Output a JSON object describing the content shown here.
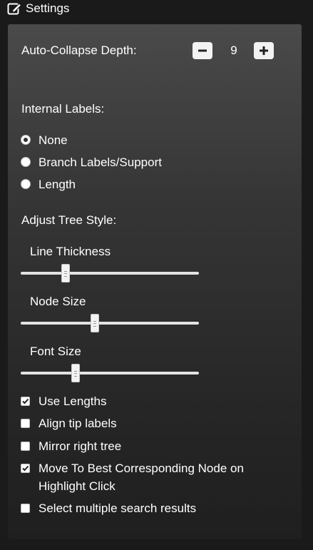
{
  "header": {
    "title": "Settings",
    "icon": "edit-icon"
  },
  "collapse": {
    "label": "Auto-Collapse Depth:",
    "value": "9"
  },
  "internal_labels": {
    "heading": "Internal Labels:",
    "options": [
      {
        "label": "None",
        "checked": true
      },
      {
        "label": "Branch Labels/Support",
        "checked": false
      },
      {
        "label": "Length",
        "checked": false
      }
    ]
  },
  "tree_style": {
    "heading": "Adjust Tree Style:",
    "sliders": [
      {
        "label": "Line Thickness",
        "level": 0.24
      },
      {
        "label": "Node Size",
        "level": 0.41
      },
      {
        "label": "Font Size",
        "level": 0.3
      }
    ]
  },
  "checkboxes": [
    {
      "label": "Use Lengths",
      "checked": true
    },
    {
      "label": "Align tip labels",
      "checked": false
    },
    {
      "label": "Mirror right tree",
      "checked": false
    },
    {
      "label": "Move To Best Corresponding Node on",
      "label2": "Highlight Click",
      "checked": true
    },
    {
      "label": "Select multiple search results",
      "checked": false
    }
  ]
}
